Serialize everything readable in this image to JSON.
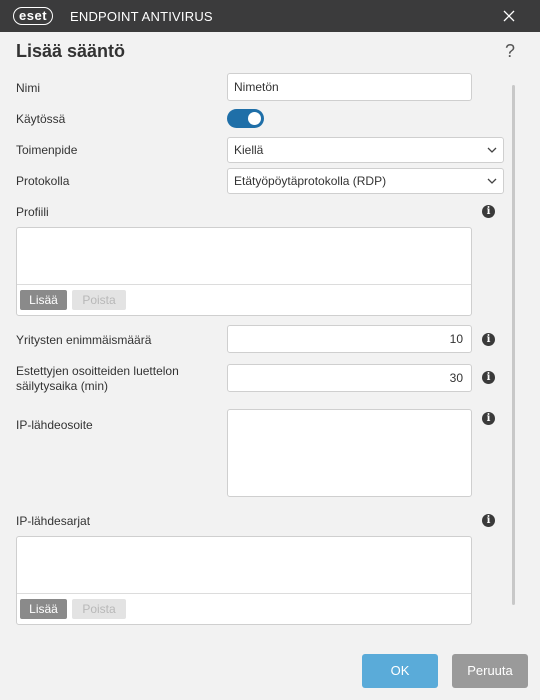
{
  "window": {
    "brand": "eset",
    "app_title": "ENDPOINT ANTIVIRUS",
    "close_icon": "close-icon"
  },
  "dialog": {
    "title": "Lisää sääntö",
    "help_icon": "?"
  },
  "form": {
    "name": {
      "label": "Nimi",
      "value": "Nimetön"
    },
    "enabled": {
      "label": "Käytössä",
      "value": true
    },
    "action": {
      "label": "Toimenpide",
      "value": "Kiellä"
    },
    "protocol": {
      "label": "Protokolla",
      "value": "Etätyöpöytäprotokolla (RDP)"
    },
    "profiles": {
      "label": "Profiili",
      "add_label": "Lisää",
      "remove_label": "Poista"
    },
    "max_attempts": {
      "label": "Yritysten enimmäismäärä",
      "value": "10"
    },
    "blocklist_retention": {
      "label": "Estettyjen osoitteiden luettelon säilytysaika (min)",
      "value": "30"
    },
    "source_ip": {
      "label": "IP-lähdeosoite",
      "value": ""
    },
    "source_ip_sets": {
      "label": "IP-lähdesarjat",
      "add_label": "Lisää",
      "remove_label": "Poista"
    }
  },
  "footer": {
    "ok_label": "OK",
    "cancel_label": "Peruuta"
  },
  "colors": {
    "titlebar": "#3b3b3c",
    "toggle_on": "#1f6fa8",
    "ok_button": "#5aabd9",
    "cancel_button": "#9a9a9a"
  }
}
